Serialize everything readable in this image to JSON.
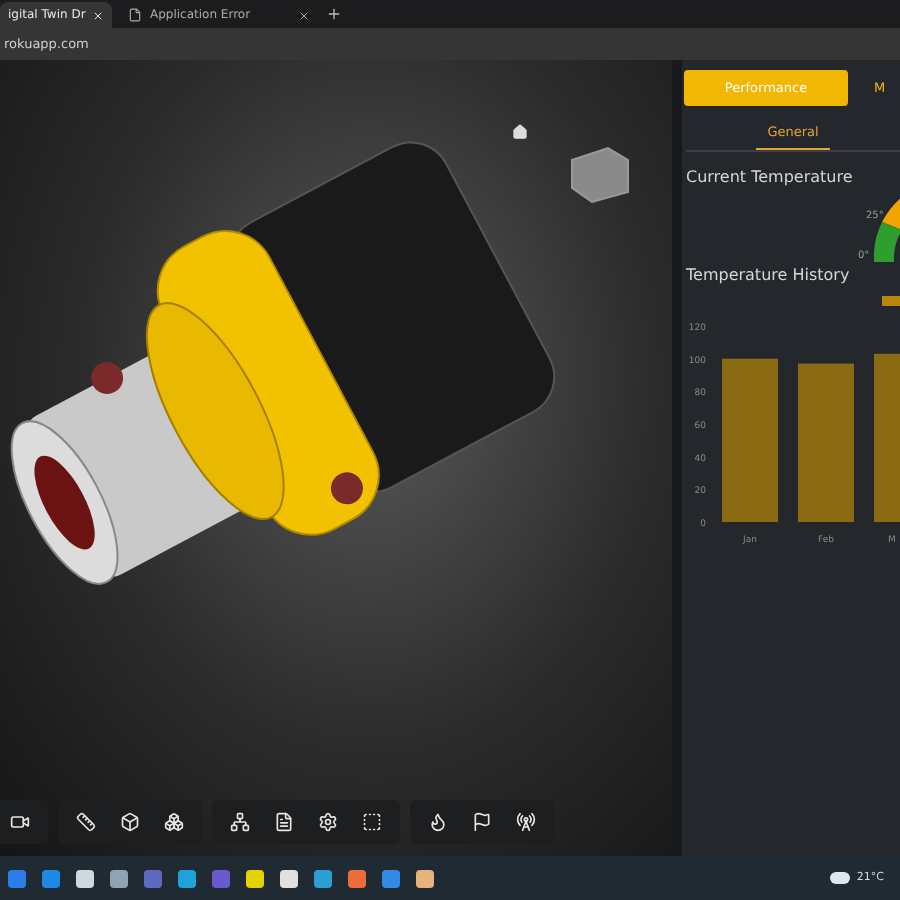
{
  "browser": {
    "tabs": [
      {
        "title": "igital Twin Dr",
        "selected": true
      },
      {
        "title": "Application Error",
        "selected": false
      }
    ],
    "address": "rokuapp.com"
  },
  "panel": {
    "buttons": [
      {
        "label": "Performance",
        "selected": true
      },
      {
        "label": "M",
        "selected": false
      }
    ],
    "subtabs": [
      {
        "label": "General",
        "selected": true
      }
    ],
    "current_temperature": {
      "title": "Current Temperature",
      "ticks": [
        "25°",
        "0°"
      ]
    },
    "history": {
      "title": "Temperature History",
      "chart_data": {
        "type": "bar",
        "categories": [
          "Jan",
          "Feb",
          "M"
        ],
        "series": [
          {
            "color": "#8a6a12",
            "values": [
              100,
              97,
              103
            ]
          }
        ],
        "ylim": [
          0,
          120
        ],
        "yticks": [
          0,
          20,
          40,
          60,
          80,
          100,
          120
        ]
      }
    }
  },
  "taskbar": {
    "weather": "21°C"
  }
}
